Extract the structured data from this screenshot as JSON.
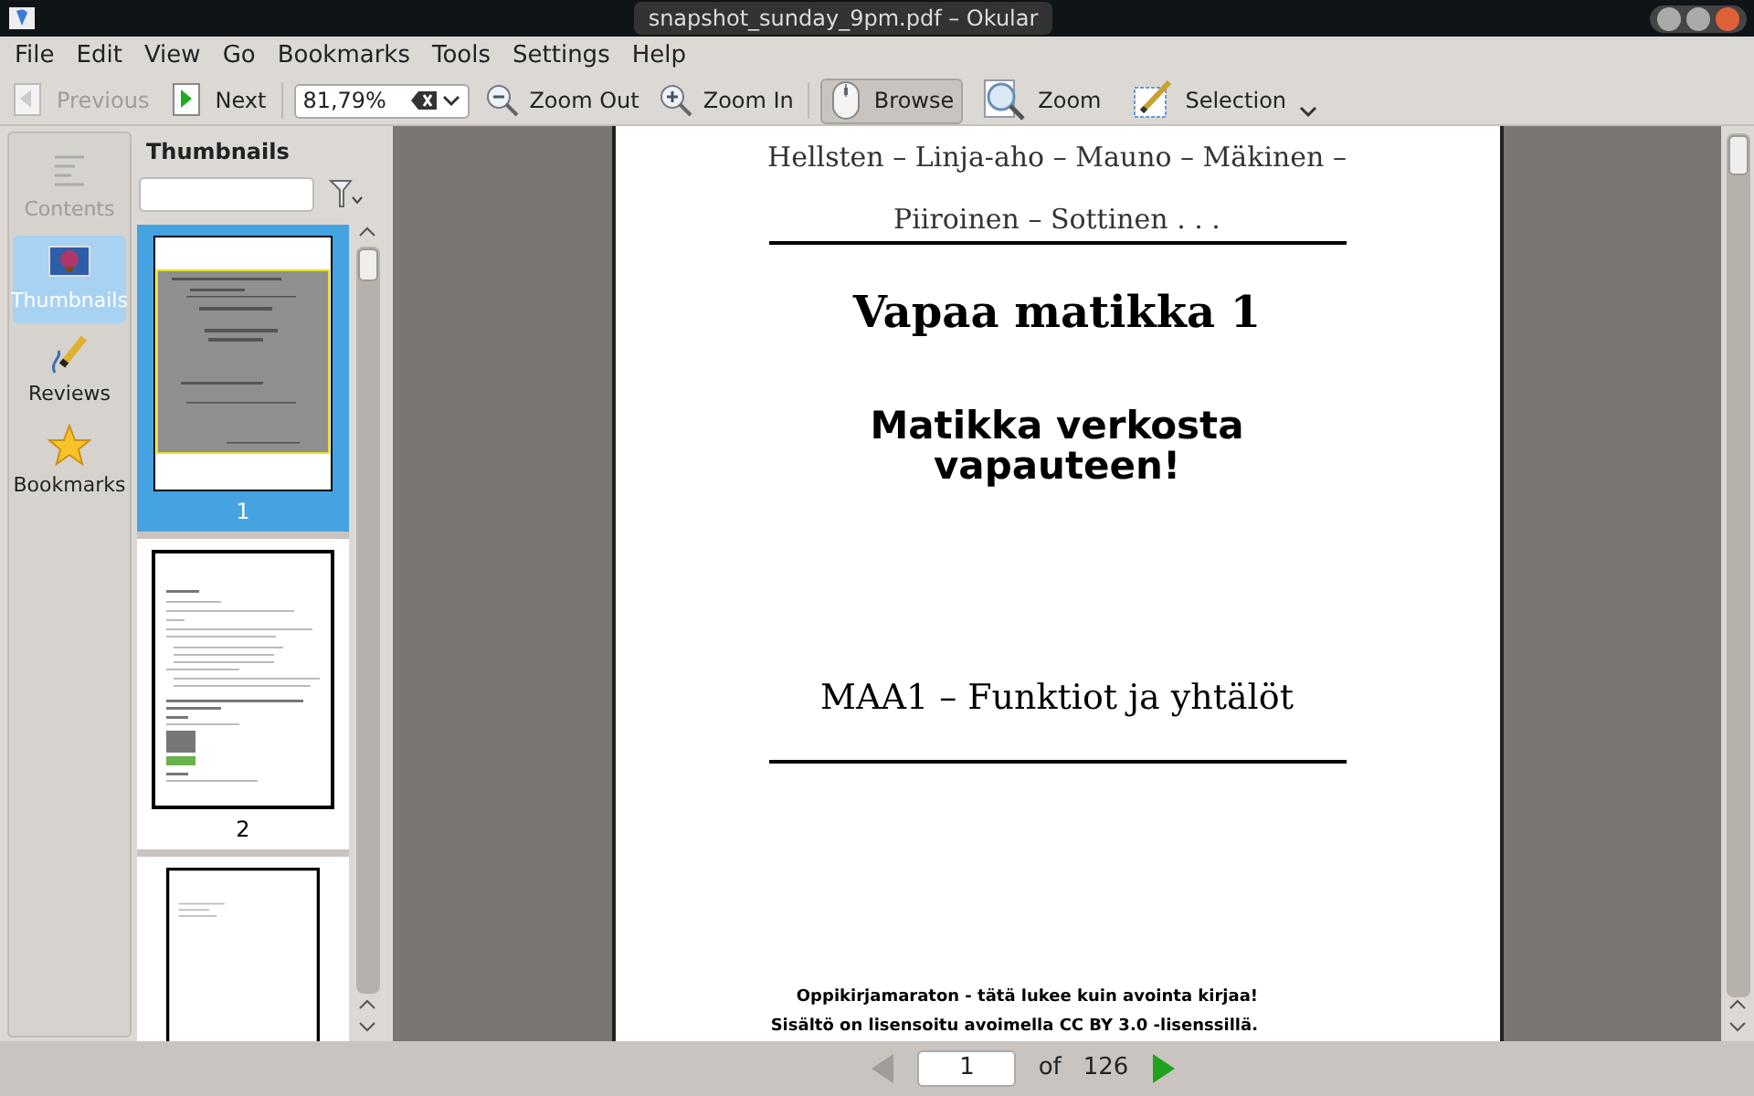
{
  "window": {
    "title": "snapshot_sunday_9pm.pdf – Okular"
  },
  "menu": [
    "File",
    "Edit",
    "View",
    "Go",
    "Bookmarks",
    "Tools",
    "Settings",
    "Help"
  ],
  "toolbar": {
    "previous": {
      "label": "Previous",
      "disabled": true
    },
    "next": {
      "label": "Next",
      "disabled": false
    },
    "zoom_value": "81,79%",
    "zoom_out": "Zoom Out",
    "zoom_in": "Zoom In",
    "tools": [
      {
        "kind": "browse",
        "label": "Browse",
        "selected": true
      },
      {
        "kind": "zoom",
        "label": "Zoom",
        "selected": false
      },
      {
        "kind": "selection",
        "label": "Selection",
        "selected": false
      }
    ]
  },
  "sidebar": {
    "items": [
      {
        "kind": "contents",
        "label": "Contents",
        "selected": false,
        "disabled": true
      },
      {
        "kind": "thumbnails",
        "label": "Thumbnails",
        "selected": true,
        "disabled": false
      },
      {
        "kind": "reviews",
        "label": "Reviews",
        "selected": false,
        "disabled": false
      },
      {
        "kind": "bookmarks",
        "label": "Bookmarks",
        "selected": false,
        "disabled": false
      }
    ]
  },
  "thumbnails": {
    "title": "Thumbnails",
    "pages": [
      {
        "kind": "cover",
        "number": "1",
        "selected": true
      },
      {
        "kind": "text",
        "number": "2",
        "selected": false
      },
      {
        "kind": "partial",
        "selected": false
      }
    ]
  },
  "document": {
    "authors": [
      "Hellsten – Linja-aho – Mauno – Mäkinen –",
      "Piiroinen – Sottinen . . ."
    ],
    "title": "Vapaa matikka 1",
    "subtitle": [
      "Matikka verkosta",
      "vapauteen!"
    ],
    "course": "MAA1 – Funktiot ja yhtälöt",
    "footer": [
      "Oppikirjamaraton - tätä lukee kuin avointa kirjaa!",
      "Sisältö on lisensoitu avoimella CC BY 3.0 -lisenssillä."
    ]
  },
  "page_nav": {
    "current": "1",
    "of": "of",
    "total": "126"
  }
}
